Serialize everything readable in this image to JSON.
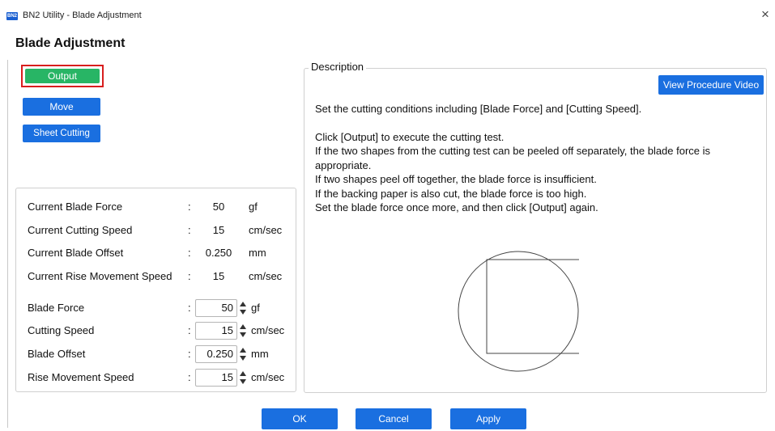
{
  "window": {
    "app_icon_text": "BN2",
    "title": "BN2 Utility - Blade Adjustment",
    "close_glyph": "×"
  },
  "page_title": "Blade Adjustment",
  "actions": {
    "output": "Output",
    "move": "Move",
    "sheet_cutting": "Sheet Cutting"
  },
  "current": [
    {
      "label": "Current Blade Force",
      "colon": ":",
      "value": "50",
      "unit": "gf"
    },
    {
      "label": "Current Cutting Speed",
      "colon": ":",
      "value": "15",
      "unit": "cm/sec"
    },
    {
      "label": "Current Blade Offset",
      "colon": ":",
      "value": "0.250",
      "unit": "mm"
    },
    {
      "label": "Current Rise Movement Speed",
      "colon": ":",
      "value": "15",
      "unit": "cm/sec"
    }
  ],
  "inputs": [
    {
      "label": "Blade Force",
      "colon": ":",
      "value": "50",
      "unit": "gf"
    },
    {
      "label": "Cutting Speed",
      "colon": ":",
      "value": "15",
      "unit": "cm/sec"
    },
    {
      "label": "Blade Offset",
      "colon": ":",
      "value": "0.250",
      "unit": "mm"
    },
    {
      "label": "Rise Movement Speed",
      "colon": ":",
      "value": "15",
      "unit": "cm/sec"
    }
  ],
  "description": {
    "legend": "Description",
    "video_button": "View Procedure Video",
    "lines": [
      "Set the cutting conditions including [Blade Force] and [Cutting Speed].",
      "Click [Output] to execute the cutting test.",
      "If the two shapes from the cutting test can be peeled off separately, the blade force is appropriate.",
      "If two shapes peel off together, the blade force is insufficient.",
      "If the backing paper is also cut, the blade force is too high.",
      "Set the blade force once more, and then click [Output] again."
    ]
  },
  "footer": {
    "ok": "OK",
    "cancel": "Cancel",
    "apply": "Apply"
  },
  "colors": {
    "primary_button": "#1a6fe0",
    "output_button": "#28b565",
    "highlight_border": "#d81e1e"
  }
}
